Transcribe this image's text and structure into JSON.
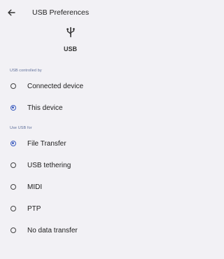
{
  "header": {
    "back_icon": "arrow-left-icon",
    "title": "USB Preferences"
  },
  "usb": {
    "icon": "usb-icon",
    "label": "USB"
  },
  "controlled_by": {
    "heading": "USB controlled by",
    "options": [
      {
        "label": "Connected device",
        "selected": false
      },
      {
        "label": "This device",
        "selected": true
      }
    ]
  },
  "use_usb_for": {
    "heading": "Use USB for",
    "options": [
      {
        "label": "File Transfer",
        "selected": true
      },
      {
        "label": "USB tethering",
        "selected": false
      },
      {
        "label": "MIDI",
        "selected": false
      },
      {
        "label": "PTP",
        "selected": false
      },
      {
        "label": "No data transfer",
        "selected": false
      }
    ]
  },
  "colors": {
    "background": "#f2f1f5",
    "accent": "#3a5bbf",
    "section_label": "#5f6f9a"
  }
}
